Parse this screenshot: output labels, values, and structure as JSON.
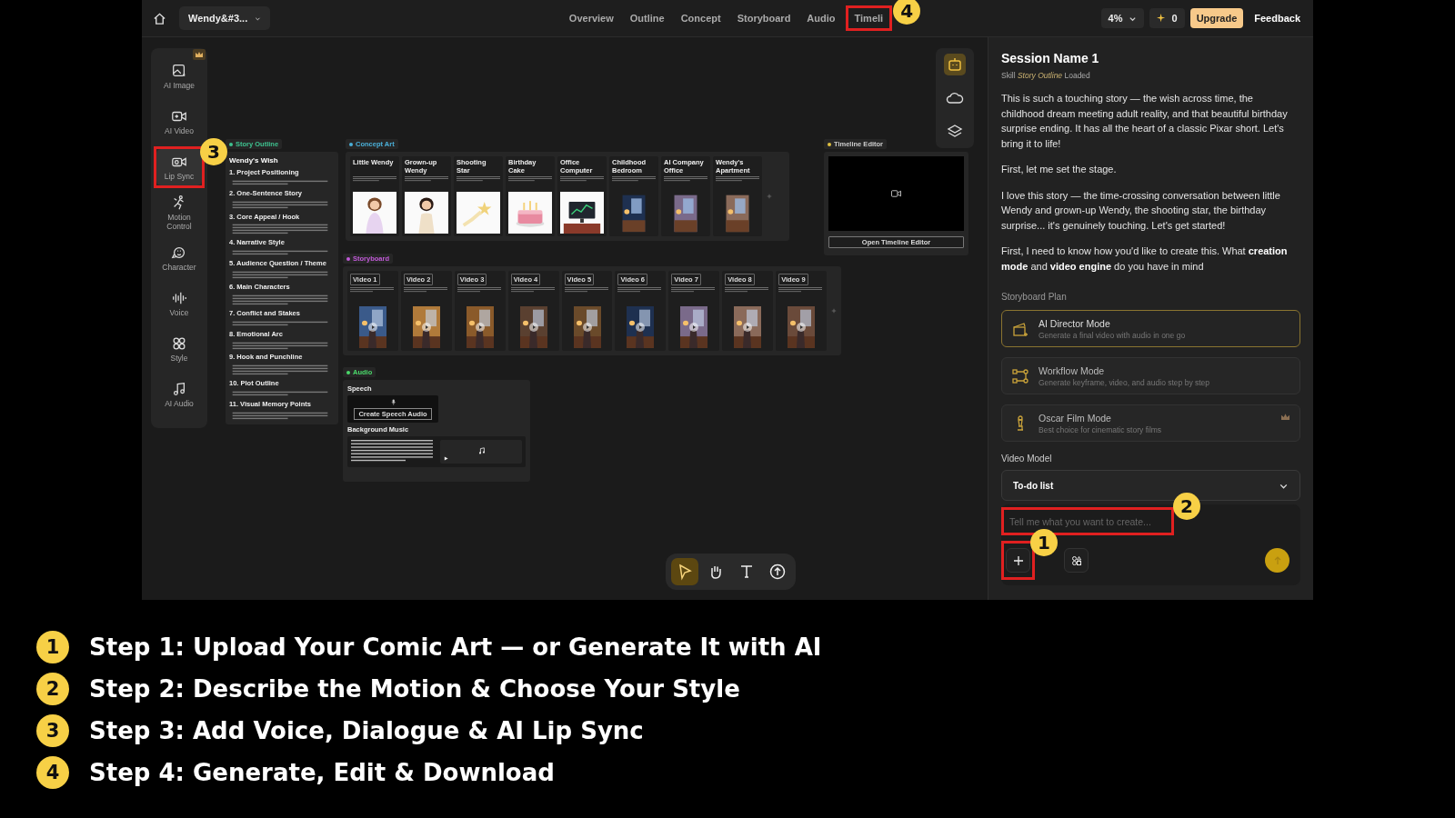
{
  "topbar": {
    "project": "Wendy&#3...",
    "zoom": "4%",
    "credits": "0",
    "upgrade": "Upgrade",
    "feedback": "Feedback",
    "nav": [
      {
        "label": "Overview",
        "selected": false
      },
      {
        "label": "Outline",
        "selected": false
      },
      {
        "label": "Concept",
        "selected": false
      },
      {
        "label": "Storyboard",
        "selected": false
      },
      {
        "label": "Audio",
        "selected": false
      },
      {
        "label": "Timeli",
        "selected": false,
        "highlight": "4"
      }
    ]
  },
  "tools": [
    {
      "label": "AI Image"
    },
    {
      "label": "AI Video"
    },
    {
      "label": "Lip Sync",
      "highlight": "3"
    },
    {
      "label": "Motion Control"
    },
    {
      "label": "Character"
    },
    {
      "label": "Voice"
    },
    {
      "label": "Style"
    },
    {
      "label": "AI Audio"
    }
  ],
  "canvas": {
    "outline": {
      "tag": "Story Outline",
      "title": "Wendy's Wish",
      "sections": [
        "1. Project Positioning",
        "2. One-Sentence Story",
        "3. Core Appeal / Hook",
        "4. Narrative Style",
        "5. Audience Question / Theme",
        "6. Main Characters",
        "7. Conflict and Stakes",
        "8. Emotional Arc",
        "9. Hook and Punchline",
        "10. Plot Outline",
        "11. Visual Memory Points"
      ]
    },
    "concept_art": {
      "tag": "Concept Art",
      "cards": [
        {
          "title": "Little Wendy",
          "kind": "isolated"
        },
        {
          "title": "Grown-up Wendy",
          "kind": "isolated"
        },
        {
          "title": "Shooting Star",
          "kind": "isolated"
        },
        {
          "title": "Birthday Cake",
          "kind": "isolated"
        },
        {
          "title": "Office Computer",
          "kind": "isolated"
        },
        {
          "title": "Childhood Bedroom",
          "kind": "scene"
        },
        {
          "title": "AI Company Office",
          "kind": "scene"
        },
        {
          "title": "Wendy's Apartment",
          "kind": "scene"
        }
      ]
    },
    "timeline": {
      "tag": "Timeline Editor",
      "button": "Open Timeline Editor"
    },
    "storyboard": {
      "tag": "Storyboard",
      "cards": [
        "Video 1",
        "Video 2",
        "Video 3",
        "Video 4",
        "Video 5",
        "Video 6",
        "Video 7",
        "Video 8",
        "Video 9"
      ]
    },
    "audio": {
      "tag": "Audio",
      "speech_label": "Speech",
      "speech_button": "Create Speech Audio",
      "music_label": "Background Music"
    },
    "toolbar": [
      {
        "selected": true
      },
      {
        "selected": false
      },
      {
        "selected": false
      },
      {
        "selected": false
      }
    ]
  },
  "panel": {
    "title": "Session Name 1",
    "skill": "Skill *Story Outline* Loaded",
    "paragraphs": [
      "This is such a touching story — the wish across time, the childhood dream meeting adult reality, and that beautiful birthday surprise ending. It has all the heart of a classic Pixar short. Let's bring it to life!",
      "First, let me set the stage.",
      "I love this story — the time-crossing conversation between little Wendy and grown-up Wendy, the shooting star, the birthday surprise... it's genuinely touching. Let's get started!",
      "First, I need to know how you'd like to create this. What **creation mode** and **video engine** do you have in mind"
    ],
    "plan_label": "Storyboard Plan",
    "modes": [
      {
        "title": "AI Director Mode",
        "subtitle": "Generate a final video with audio in one go",
        "selected": true,
        "premium": false
      },
      {
        "title": "Workflow Mode",
        "subtitle": "Generate keyframe, video, and audio step by step",
        "selected": false,
        "premium": false
      },
      {
        "title": "Oscar Film Mode",
        "subtitle": "Best choice for cinematic story films",
        "selected": false,
        "premium": true
      }
    ],
    "model_label": "Video Model",
    "model_value": "To-do list",
    "input": {
      "placeholder": "Tell me what you want to create...",
      "highlight": "2"
    },
    "add_highlight": "1"
  },
  "steps": [
    {
      "number": "1",
      "text": "Step 1: Upload Your Comic Art — or Generate It with AI"
    },
    {
      "number": "2",
      "text": "Step 2: Describe the Motion & Choose Your Style"
    },
    {
      "number": "3",
      "text": "Step 3: Add Voice, Dialogue & AI Lip Sync"
    },
    {
      "number": "4",
      "text": "Step 4: Generate, Edit & Download"
    }
  ]
}
